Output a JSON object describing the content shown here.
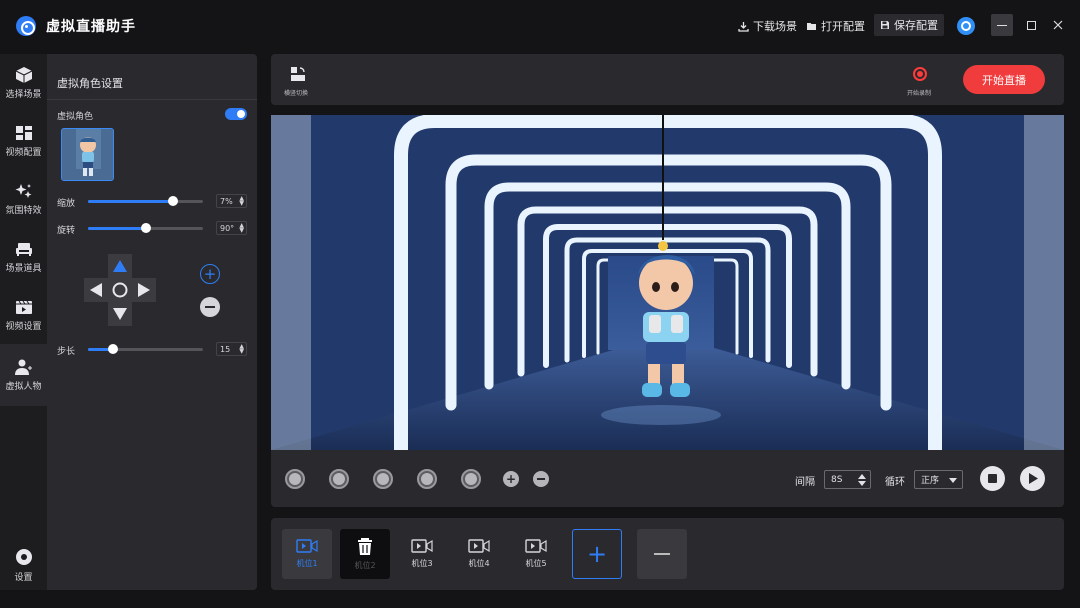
{
  "app": {
    "title": "虚拟直播助手"
  },
  "titlebar": {
    "download_scene": "下载场景",
    "open_config": "打开配置",
    "save_config": "保存配置"
  },
  "nav": {
    "items": [
      {
        "label": "选择场景",
        "icon": "cube-icon"
      },
      {
        "label": "视频配置",
        "icon": "layout-icon"
      },
      {
        "label": "氛围特效",
        "icon": "sparkle-icon"
      },
      {
        "label": "场景道具",
        "icon": "couch-icon"
      },
      {
        "label": "视频设置",
        "icon": "film-icon"
      },
      {
        "label": "虚拟人物",
        "icon": "person-icon"
      }
    ],
    "settings_label": "设置"
  },
  "panel": {
    "title": "虚拟角色设置",
    "avatar_label": "虚拟角色",
    "avatar_enabled": true,
    "scale": {
      "label": "缩放",
      "value": "7%",
      "level": 0.74
    },
    "rotate": {
      "label": "旋转",
      "value": "90°",
      "level": 0.5
    },
    "step": {
      "label": "步长",
      "value": "15",
      "level": 0.22
    }
  },
  "toolbar": {
    "orientation_label": "横竖切换",
    "record_label": "开始录制",
    "live_label": "开始直播"
  },
  "controls": {
    "interval_label": "间隔",
    "interval_value": "8S",
    "loop_label": "循环",
    "loop_value": "正序"
  },
  "cameras": [
    {
      "label": "机位1",
      "state": "active"
    },
    {
      "label": "机位2",
      "state": "delete"
    },
    {
      "label": "机位3",
      "state": "normal"
    },
    {
      "label": "机位4",
      "state": "normal"
    },
    {
      "label": "机位5",
      "state": "normal"
    }
  ],
  "colors": {
    "accent": "#2f7df6",
    "live": "#f03c3c",
    "record": "#ff3b3b",
    "panel": "#2a2a2e",
    "background": "#141416"
  }
}
